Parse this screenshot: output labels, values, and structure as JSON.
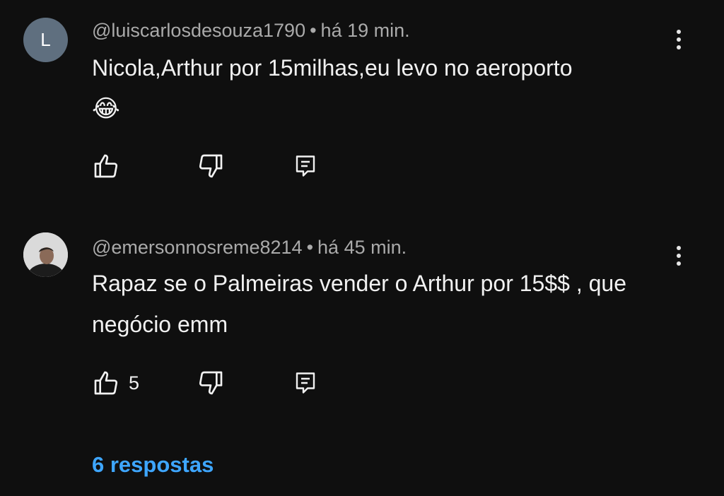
{
  "comments": [
    {
      "avatar_letter": "L",
      "avatar_color": "#5f6f7f",
      "username": "@luiscarlosdesouza1790",
      "separator": "•",
      "time": "há 19 min.",
      "text": "Nicola,Arthur por 15milhas,eu levo no aeroporto",
      "emoji": "😂",
      "likes": "",
      "icons": [
        "like-icon",
        "dislike-icon",
        "reply-icon",
        "more-vert-icon"
      ]
    },
    {
      "avatar_letter": "",
      "username": "@emersonnosreme8214",
      "separator": "•",
      "time": "há 45 min.",
      "text": "Rapaz se o Palmeiras vender o Arthur por 15$$ , que negócio emm",
      "likes": "5",
      "icons": [
        "like-icon",
        "dislike-icon",
        "reply-icon",
        "more-vert-icon"
      ]
    }
  ],
  "replies_link": "6 respostas",
  "colors": {
    "background": "#0f0f0f",
    "text": "#f1f1f1",
    "meta": "#aaaaaa",
    "link": "#3ea6ff"
  }
}
